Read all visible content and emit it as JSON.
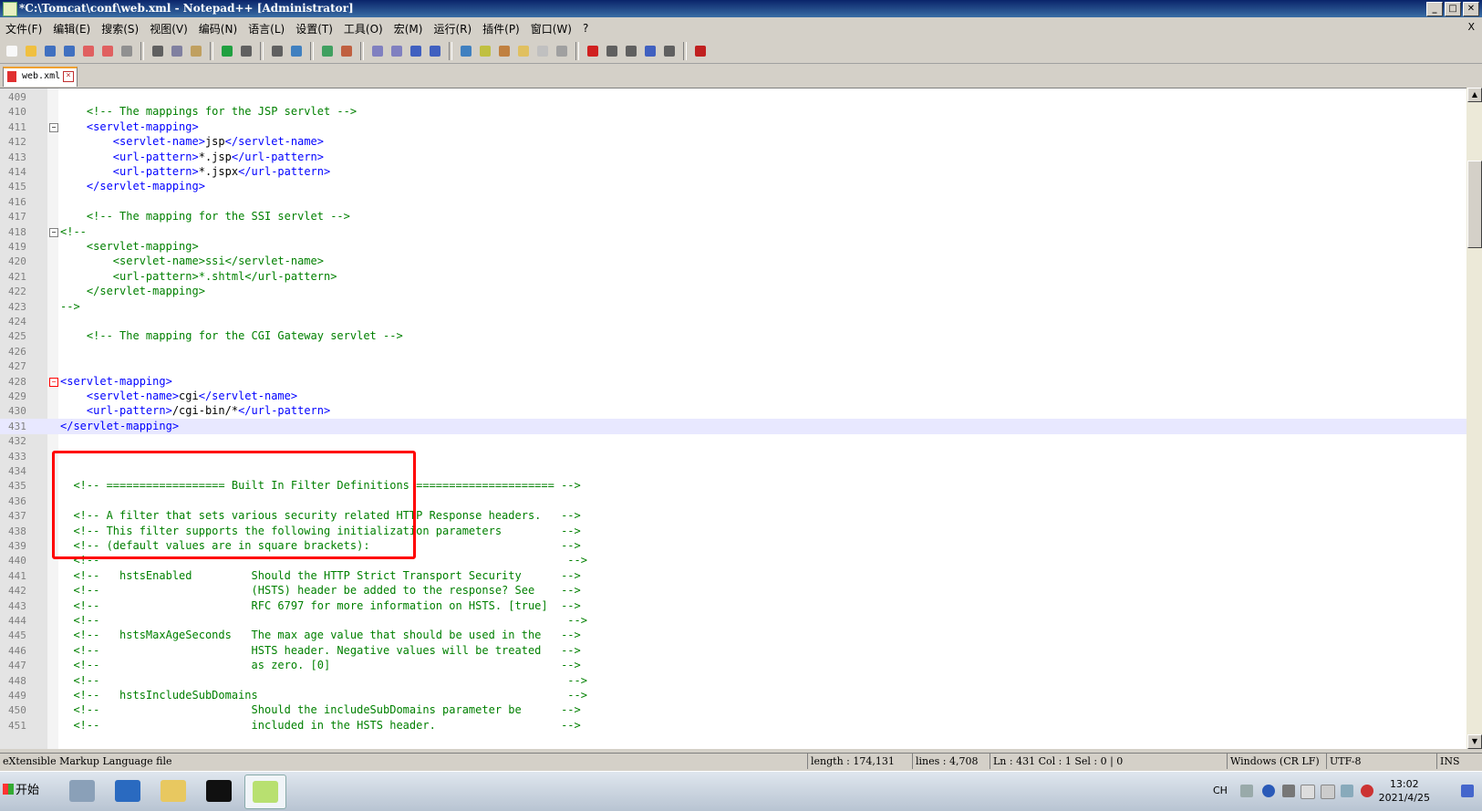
{
  "window": {
    "title": "*C:\\Tomcat\\conf\\web.xml - Notepad++ [Administrator]",
    "controls": [
      "_",
      "□",
      "✕"
    ]
  },
  "menubar": {
    "items": [
      "文件(F)",
      "编辑(E)",
      "搜索(S)",
      "视图(V)",
      "编码(N)",
      "语言(L)",
      "设置(T)",
      "工具(O)",
      "宏(M)",
      "运行(R)",
      "插件(P)",
      "窗口(W)",
      "?"
    ],
    "close": "X"
  },
  "toolbar": {
    "icons": [
      "new-file-icon",
      "open-file-icon",
      "save-icon",
      "save-all-icon",
      "close-icon",
      "close-all-icon",
      "print-icon",
      "cut-icon",
      "copy-icon",
      "paste-icon",
      "undo-icon",
      "redo-icon",
      "find-icon",
      "replace-icon",
      "zoom-in-icon",
      "zoom-out-icon",
      "sync-vertical-icon",
      "sync-horizontal-icon",
      "word-wrap-icon",
      "show-all-chars-icon",
      "indent-guide-icon",
      "doc-map-icon",
      "function-list-icon",
      "folder-workspace-icon",
      "doc-list-icon",
      "monitoring-icon",
      "record-macro-icon",
      "stop-record-icon",
      "play-macro-icon",
      "run-macro-multiple-icon",
      "save-macro-icon",
      "spell-check-icon"
    ]
  },
  "tabs": [
    {
      "label": "web.xml",
      "active": true
    }
  ],
  "editor": {
    "current_line": "431",
    "lines": [
      {
        "n": "409",
        "fold": "",
        "segs": []
      },
      {
        "n": "410",
        "fold": "",
        "segs": [
          {
            "t": "    <!-- The mappings for the JSP servlet -->",
            "k": "c"
          }
        ]
      },
      {
        "n": "411",
        "fold": "−",
        "segs": [
          {
            "t": "    <servlet-mapping>",
            "k": "tg"
          }
        ]
      },
      {
        "n": "412",
        "fold": "",
        "segs": [
          {
            "t": "        <servlet-name>",
            "k": "tg"
          },
          {
            "t": "jsp",
            "k": "tx"
          },
          {
            "t": "</servlet-name>",
            "k": "tg"
          }
        ]
      },
      {
        "n": "413",
        "fold": "",
        "segs": [
          {
            "t": "        <url-pattern>",
            "k": "tg"
          },
          {
            "t": "*.jsp",
            "k": "tx"
          },
          {
            "t": "</url-pattern>",
            "k": "tg"
          }
        ]
      },
      {
        "n": "414",
        "fold": "",
        "segs": [
          {
            "t": "        <url-pattern>",
            "k": "tg"
          },
          {
            "t": "*.jspx",
            "k": "tx"
          },
          {
            "t": "</url-pattern>",
            "k": "tg"
          }
        ]
      },
      {
        "n": "415",
        "fold": "",
        "segs": [
          {
            "t": "    </servlet-mapping>",
            "k": "tg"
          }
        ]
      },
      {
        "n": "416",
        "fold": "",
        "segs": []
      },
      {
        "n": "417",
        "fold": "",
        "segs": [
          {
            "t": "    <!-- The mapping for the SSI servlet -->",
            "k": "c"
          }
        ]
      },
      {
        "n": "418",
        "fold": "−",
        "segs": [
          {
            "t": "<!--",
            "k": "c"
          }
        ]
      },
      {
        "n": "419",
        "fold": "",
        "segs": [
          {
            "t": "    <servlet-mapping>",
            "k": "c"
          }
        ]
      },
      {
        "n": "420",
        "fold": "",
        "segs": [
          {
            "t": "        <servlet-name>ssi</servlet-name>",
            "k": "c"
          }
        ]
      },
      {
        "n": "421",
        "fold": "",
        "segs": [
          {
            "t": "        <url-pattern>*.shtml</url-pattern>",
            "k": "c"
          }
        ]
      },
      {
        "n": "422",
        "fold": "",
        "segs": [
          {
            "t": "    </servlet-mapping>",
            "k": "c"
          }
        ]
      },
      {
        "n": "423",
        "fold": "",
        "segs": [
          {
            "t": "-->",
            "k": "c"
          }
        ]
      },
      {
        "n": "424",
        "fold": "",
        "segs": []
      },
      {
        "n": "425",
        "fold": "",
        "segs": [
          {
            "t": "    <!-- The mapping for the CGI Gateway servlet -->",
            "k": "c"
          }
        ]
      },
      {
        "n": "426",
        "fold": "",
        "segs": []
      },
      {
        "n": "427",
        "fold": "",
        "segs": []
      },
      {
        "n": "428",
        "fold": "−",
        "segs": [
          {
            "t": "<servlet-mapping>",
            "k": "tg"
          }
        ]
      },
      {
        "n": "429",
        "fold": "",
        "segs": [
          {
            "t": "    <servlet-name>",
            "k": "tg"
          },
          {
            "t": "cgi",
            "k": "tx"
          },
          {
            "t": "</servlet-name>",
            "k": "tg"
          }
        ]
      },
      {
        "n": "430",
        "fold": "",
        "segs": [
          {
            "t": "    <url-pattern>",
            "k": "tg"
          },
          {
            "t": "/cgi-bin/*",
            "k": "tx"
          },
          {
            "t": "</url-pattern>",
            "k": "tg"
          }
        ]
      },
      {
        "n": "431",
        "fold": "",
        "segs": [
          {
            "t": "</servlet-mapping>",
            "k": "tg"
          }
        ]
      },
      {
        "n": "432",
        "fold": "",
        "segs": []
      },
      {
        "n": "433",
        "fold": "",
        "segs": []
      },
      {
        "n": "434",
        "fold": "",
        "segs": []
      },
      {
        "n": "435",
        "fold": "",
        "segs": [
          {
            "t": "  <!-- ================== Built In Filter Definitions ===================== -->",
            "k": "c"
          }
        ]
      },
      {
        "n": "436",
        "fold": "",
        "segs": []
      },
      {
        "n": "437",
        "fold": "",
        "segs": [
          {
            "t": "  <!-- A filter that sets various security related HTTP Response headers.   -->",
            "k": "c"
          }
        ]
      },
      {
        "n": "438",
        "fold": "",
        "segs": [
          {
            "t": "  <!-- This filter supports the following initialization parameters         -->",
            "k": "c"
          }
        ]
      },
      {
        "n": "439",
        "fold": "",
        "segs": [
          {
            "t": "  <!-- (default values are in square brackets):                             -->",
            "k": "c"
          }
        ]
      },
      {
        "n": "440",
        "fold": "",
        "segs": [
          {
            "t": "  <!--                                                                       -->",
            "k": "c"
          }
        ]
      },
      {
        "n": "441",
        "fold": "",
        "segs": [
          {
            "t": "  <!--   hstsEnabled         Should the HTTP Strict Transport Security      -->",
            "k": "c"
          }
        ]
      },
      {
        "n": "442",
        "fold": "",
        "segs": [
          {
            "t": "  <!--                       (HSTS) header be added to the response? See    -->",
            "k": "c"
          }
        ]
      },
      {
        "n": "443",
        "fold": "",
        "segs": [
          {
            "t": "  <!--                       RFC 6797 for more information on HSTS. [true]  -->",
            "k": "c"
          }
        ]
      },
      {
        "n": "444",
        "fold": "",
        "segs": [
          {
            "t": "  <!--                                                                       -->",
            "k": "c"
          }
        ]
      },
      {
        "n": "445",
        "fold": "",
        "segs": [
          {
            "t": "  <!--   hstsMaxAgeSeconds   The max age value that should be used in the   -->",
            "k": "c"
          }
        ]
      },
      {
        "n": "446",
        "fold": "",
        "segs": [
          {
            "t": "  <!--                       HSTS header. Negative values will be treated   -->",
            "k": "c"
          }
        ]
      },
      {
        "n": "447",
        "fold": "",
        "segs": [
          {
            "t": "  <!--                       as zero. [0]                                   -->",
            "k": "c"
          }
        ]
      },
      {
        "n": "448",
        "fold": "",
        "segs": [
          {
            "t": "  <!--                                                                       -->",
            "k": "c"
          }
        ]
      },
      {
        "n": "449",
        "fold": "",
        "segs": [
          {
            "t": "  <!--   hstsIncludeSubDomains                                               -->",
            "k": "c"
          }
        ]
      },
      {
        "n": "450",
        "fold": "",
        "segs": [
          {
            "t": "  <!--                       Should the includeSubDomains parameter be      -->",
            "k": "c"
          }
        ]
      },
      {
        "n": "451",
        "fold": "",
        "segs": [
          {
            "t": "  <!--                       included in the HSTS header.                   -->",
            "k": "c"
          }
        ]
      }
    ]
  },
  "statusbar": {
    "filetype": "eXtensible Markup Language file",
    "length": "length : 174,131",
    "lines": "lines : 4,708",
    "position": "Ln : 431    Col : 1    Sel : 0 | 0",
    "eol": "Windows (CR LF)",
    "encoding": "UTF-8",
    "mode": "INS"
  },
  "taskbar": {
    "start_label": "开始",
    "apps": [
      "server-manager-icon",
      "powershell-icon",
      "explorer-icon",
      "cmd-icon",
      "notepadpp-icon"
    ],
    "tray_lang": "CH",
    "time": "13:02",
    "date": "2021/4/25"
  },
  "colors": {
    "comment": "#008000",
    "tag": "#0000ff",
    "highlight_box": "#ff0000",
    "current_line": "#e8e8ff"
  }
}
